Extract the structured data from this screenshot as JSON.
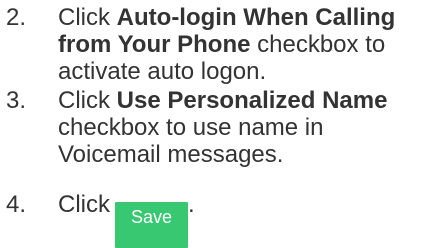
{
  "steps": [
    {
      "number": "2.",
      "before": "Click ",
      "bold": "Auto-login When Calling from Your Phone",
      "after": " checkbox to activate auto logon."
    },
    {
      "number": "3.",
      "before": "Click ",
      "bold": "Use Personalized Name",
      "after": " checkbox to use name in Voicemail messages."
    },
    {
      "number": "4.",
      "before": "Click",
      "button_label": "Save",
      "after": "."
    }
  ],
  "colors": {
    "save_button_bg": "#37c871",
    "save_button_text": "#ffffff",
    "body_text": "#333333"
  }
}
